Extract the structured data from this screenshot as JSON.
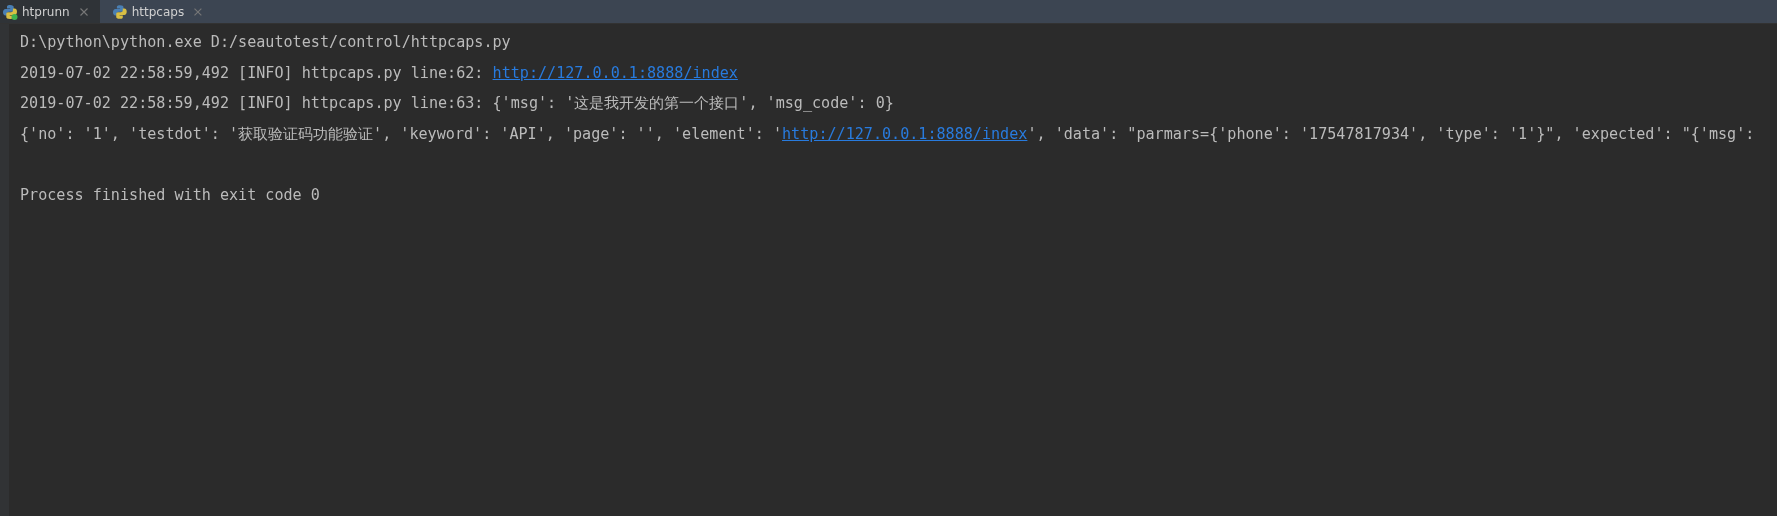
{
  "tabs": [
    {
      "label": "htprunn",
      "selected": false,
      "running": true
    },
    {
      "label": "httpcaps",
      "selected": true,
      "running": false
    }
  ],
  "console": {
    "lines": [
      {
        "segments": [
          {
            "kind": "text",
            "text": "D:\\python\\python.exe D:/seautotest/control/httpcaps.py"
          }
        ]
      },
      {
        "segments": [
          {
            "kind": "text",
            "text": "2019-07-02 22:58:59,492 [INFO] httpcaps.py line:62: "
          },
          {
            "kind": "link",
            "text": "http://127.0.0.1:8888/index"
          }
        ]
      },
      {
        "segments": [
          {
            "kind": "text",
            "text": "2019-07-02 22:58:59,492 [INFO] httpcaps.py line:63: {'msg': '这是我开发的第一个接口', 'msg_code': 0}"
          }
        ]
      },
      {
        "segments": [
          {
            "kind": "text",
            "text": "{'no': '1', 'testdot': '获取验证码功能验证', 'keyword': 'API', 'page': '', 'element': '"
          },
          {
            "kind": "link",
            "text": "http://127.0.0.1:8888/index"
          },
          {
            "kind": "text",
            "text": "', 'data': \"parmars={'phone': '17547817934', 'type': '1'}\", 'expected': \"{'msg':"
          }
        ]
      },
      {
        "kind": "blank"
      },
      {
        "segments": [
          {
            "kind": "text",
            "text": "Process finished with exit code 0"
          }
        ]
      }
    ]
  }
}
